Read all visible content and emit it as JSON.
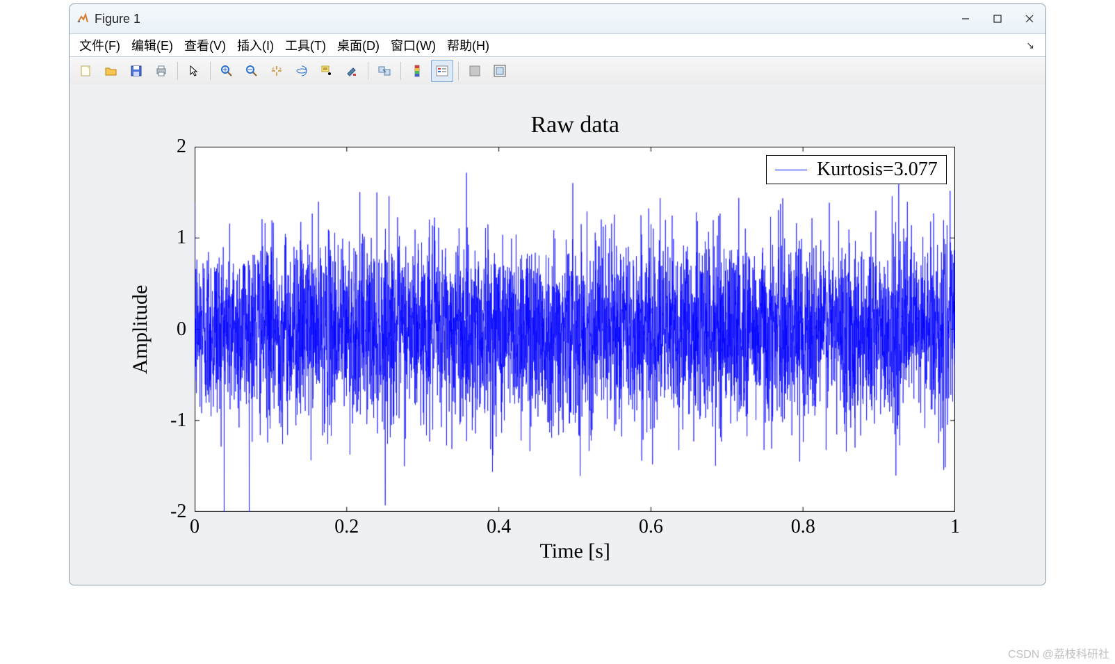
{
  "window": {
    "title": "Figure 1"
  },
  "menu": {
    "items": [
      "文件(F)",
      "编辑(E)",
      "查看(V)",
      "插入(I)",
      "工具(T)",
      "桌面(D)",
      "窗口(W)",
      "帮助(H)"
    ]
  },
  "toolbar": {
    "buttons": [
      {
        "name": "new-figure-icon"
      },
      {
        "name": "open-icon"
      },
      {
        "name": "save-icon"
      },
      {
        "name": "print-icon"
      },
      {
        "sep": true
      },
      {
        "name": "pointer-icon"
      },
      {
        "sep": true
      },
      {
        "name": "zoom-in-icon"
      },
      {
        "name": "zoom-out-icon"
      },
      {
        "name": "pan-icon"
      },
      {
        "name": "rotate3d-icon"
      },
      {
        "name": "data-cursor-icon"
      },
      {
        "name": "brush-icon"
      },
      {
        "sep": true
      },
      {
        "name": "link-plot-icon"
      },
      {
        "sep": true
      },
      {
        "name": "colorbar-icon"
      },
      {
        "name": "legend-icon",
        "active": true
      },
      {
        "sep": true
      },
      {
        "name": "hide-tools-icon"
      },
      {
        "name": "dock-icon"
      }
    ]
  },
  "chart_data": {
    "type": "line",
    "title": "Raw data",
    "xlabel": "Time [s]",
    "ylabel": "Amplitude",
    "xlim": [
      0,
      1
    ],
    "ylim": [
      -2,
      2
    ],
    "xticks": [
      0,
      0.2,
      0.4,
      0.6,
      0.8,
      1
    ],
    "yticks": [
      -2,
      -1,
      0,
      1,
      2
    ],
    "legend": {
      "position": "northeast",
      "entries": [
        "Kurtosis=3.077"
      ]
    },
    "series": [
      {
        "name": "Kurtosis=3.077",
        "color": "#0000ff",
        "description": "Dense raw signal, approx Gaussian noise with kurtosis ≈ 3.077, ~many samples over 0..1 s, amplitude roughly within ±2, typical peaks ±1 to ±1.6, occasional outliers near ±2.",
        "n_samples_estimate": 5000,
        "noise_std_estimate": 0.5,
        "x_range": [
          0,
          1
        ],
        "observed_amplitude_range": [
          -2.0,
          2.1
        ]
      }
    ]
  },
  "watermark": "CSDN @荔枝科研社"
}
